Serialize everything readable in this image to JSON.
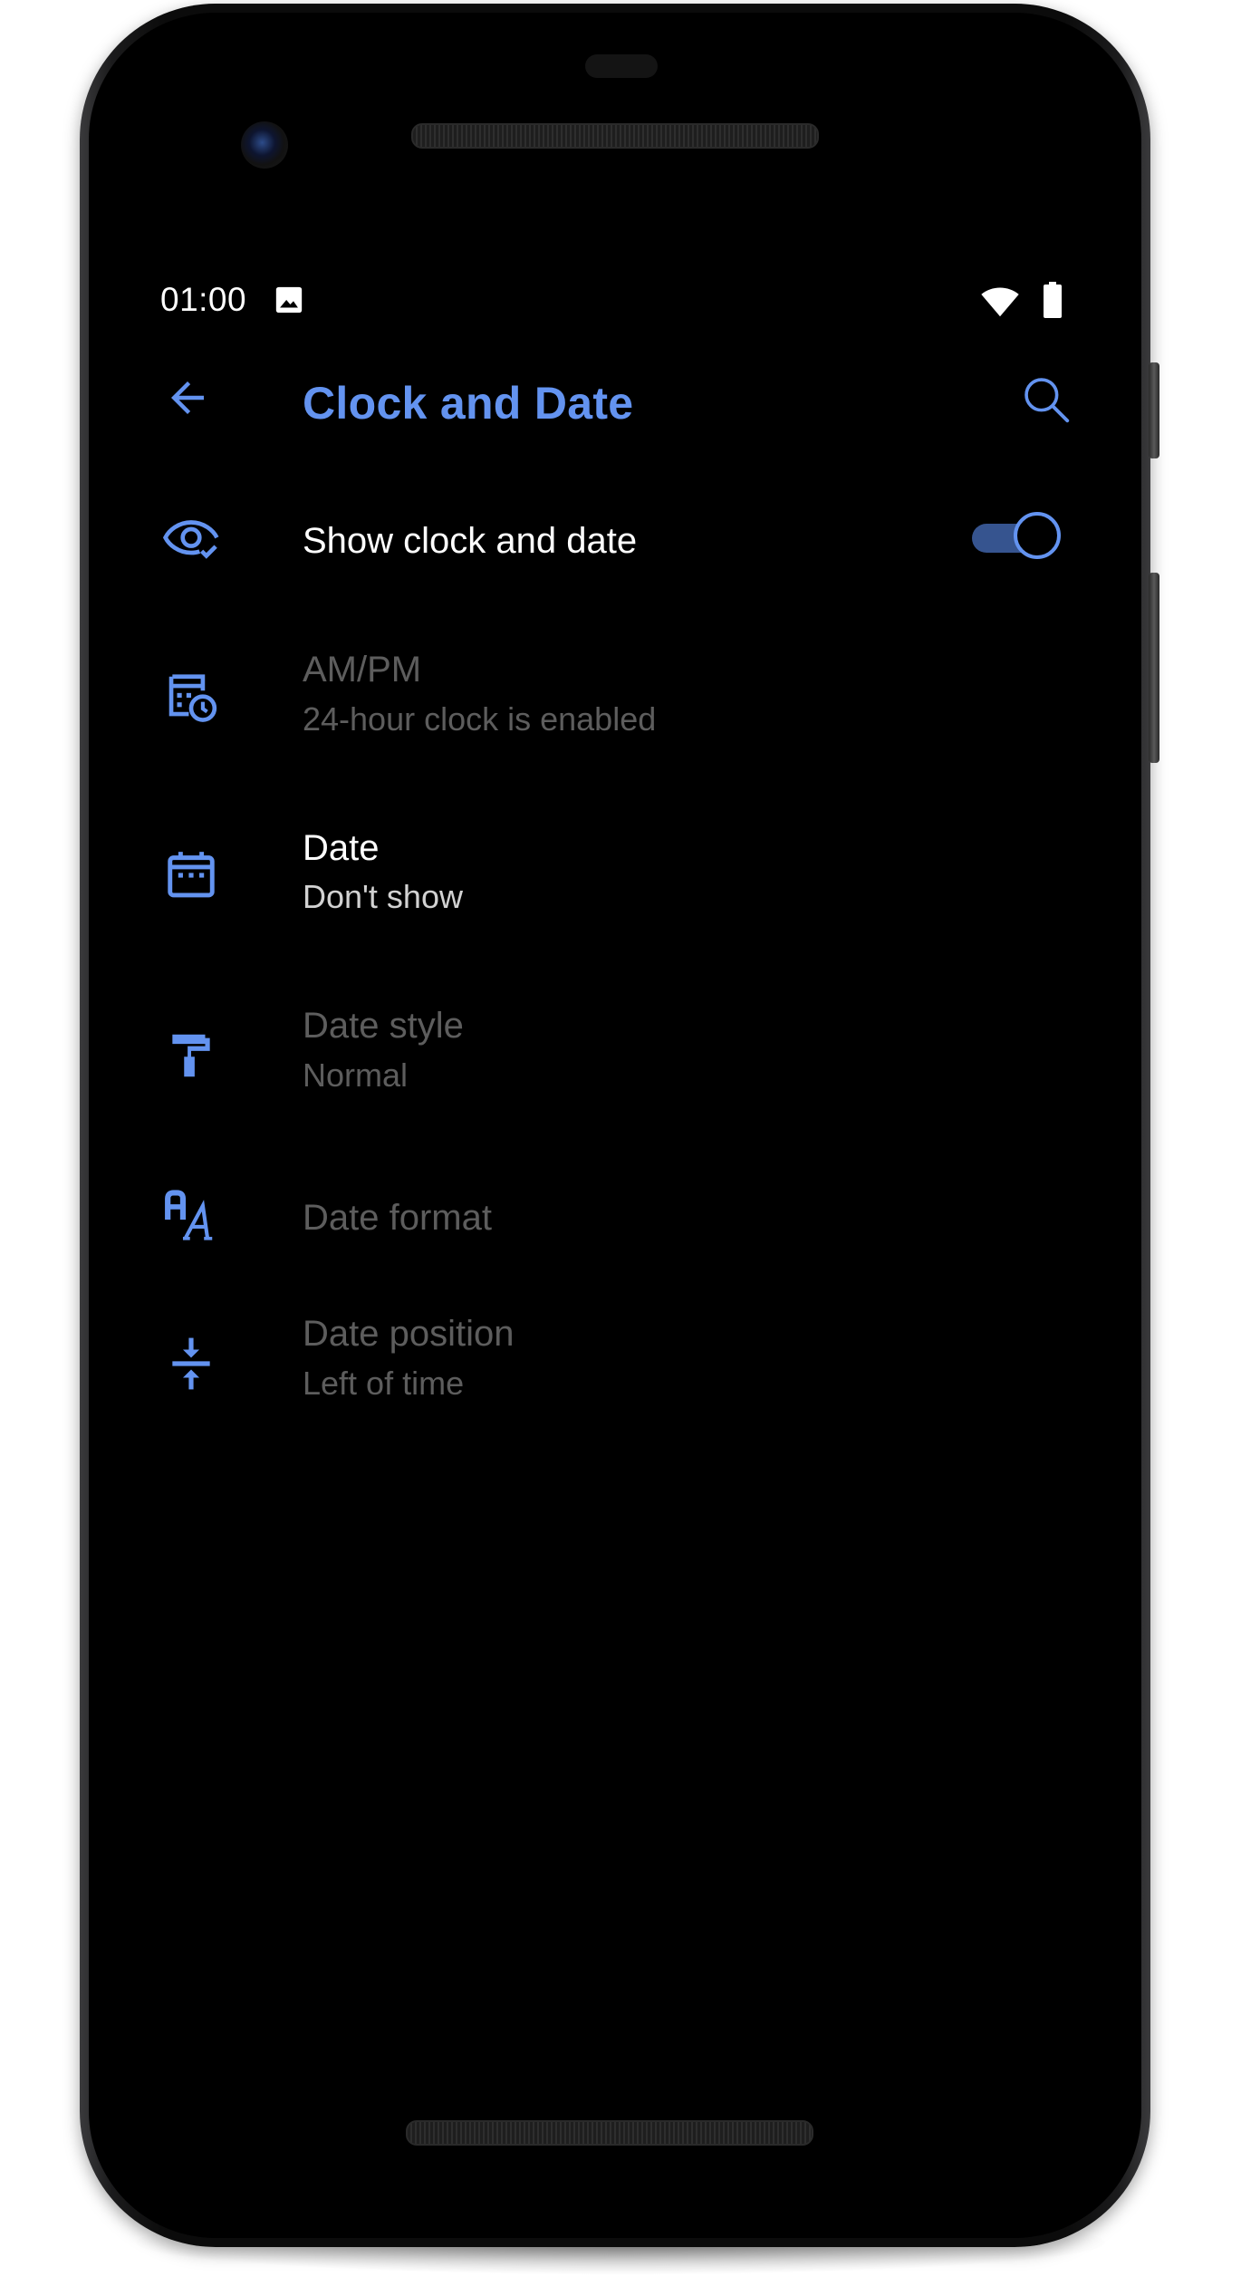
{
  "status_bar": {
    "time": "01:00",
    "icons": [
      "image-icon",
      "wifi-icon",
      "battery-icon"
    ]
  },
  "toolbar": {
    "title": "Clock and Date",
    "back_icon": "arrow-left-icon",
    "search_icon": "search-icon"
  },
  "settings": [
    {
      "title": "Show clock and date",
      "icon": "eye-check-icon",
      "enabled": true,
      "toggle": true
    },
    {
      "title": "AM/PM",
      "subtitle": "24-hour clock is enabled",
      "icon": "calendar-clock-icon",
      "enabled": false
    },
    {
      "title": "Date",
      "subtitle": "Don't show",
      "icon": "calendar-icon",
      "enabled": true
    },
    {
      "title": "Date style",
      "subtitle": "Normal",
      "icon": "paint-roller-icon",
      "enabled": false
    },
    {
      "title": "Date format",
      "icon": "font-format-icon",
      "enabled": false
    },
    {
      "title": "Date position",
      "subtitle": "Left of time",
      "icon": "vertical-align-center-icon",
      "enabled": false
    }
  ],
  "colors": {
    "accent": "#6393f0",
    "toggle_track": "#36548f",
    "background": "#000000",
    "disabled_text": "#5d5d5d"
  }
}
